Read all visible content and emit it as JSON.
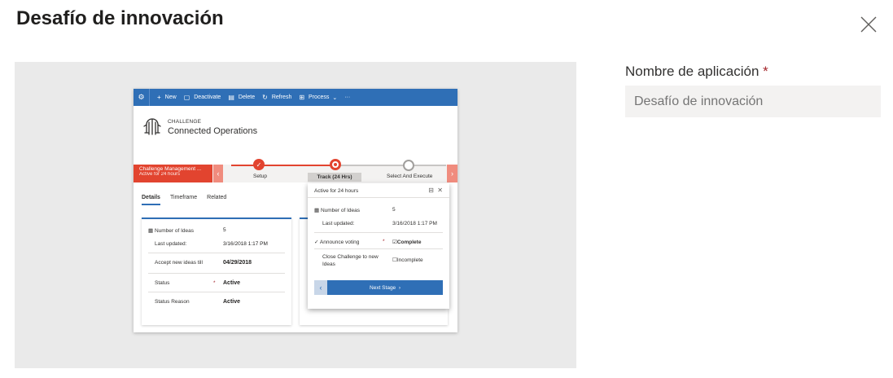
{
  "dialog": {
    "title": "Desafío de innovación",
    "close_icon": "close-icon"
  },
  "form": {
    "label": "Nombre de aplicación",
    "required_mark": "*",
    "input_placeholder": "Desafío de innovación"
  },
  "preview": {
    "commands": [
      {
        "icon": "plus-icon",
        "label": "New"
      },
      {
        "icon": "deactivate-icon",
        "label": "Deactivate"
      },
      {
        "icon": "delete-icon",
        "label": "Delete"
      },
      {
        "icon": "refresh-icon",
        "label": "Refresh"
      },
      {
        "icon": "process-icon",
        "label": "Process"
      }
    ],
    "more": "···",
    "record_type": "CHALLENGE",
    "record_name": "Connected Operations",
    "bpf": {
      "active_name": "Challenge Management ...",
      "active_time": "Active for 24 hours",
      "stages": [
        "Setup",
        "Track (24 Hrs)",
        "Select And Execute"
      ]
    },
    "tabs": [
      "Details",
      "Timeframe",
      "Related"
    ],
    "card": {
      "rows": [
        {
          "key": "Number of Ideas",
          "value": "5"
        },
        {
          "key": "Last updated:",
          "value": "3/16/2018 1:17 PM"
        },
        {
          "key": "Accept new ideas till",
          "value": "04/29/2018"
        },
        {
          "key": "Status",
          "value": "Active",
          "required": "*"
        },
        {
          "key": "Status Reason",
          "value": "Active"
        }
      ]
    },
    "flyout": {
      "header": "Active for 24 hours",
      "rows": [
        {
          "key": "Number of Ideas",
          "value": "5"
        },
        {
          "key": "Last updated:",
          "value": "3/16/2018 1:17 PM"
        },
        {
          "key": "Announce voting",
          "required": "*",
          "value": "Complete"
        },
        {
          "key": "Close Challenge to new Ideas",
          "value": "Incomplete"
        }
      ],
      "next_stage": "Next Stage"
    }
  },
  "colors": {
    "accent": "#2f6fb6",
    "stage_red": "#e2442f",
    "panel_bg": "#eaeaea"
  }
}
